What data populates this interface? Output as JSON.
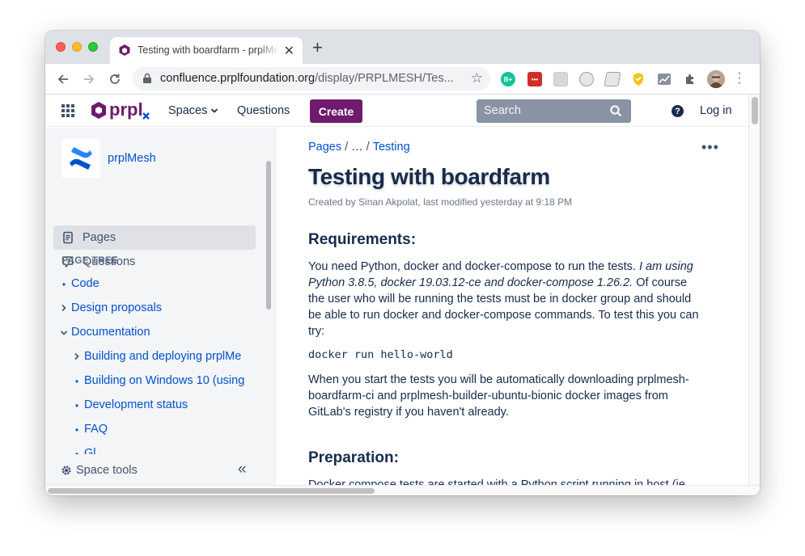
{
  "browser": {
    "tab_title": "Testing with boardfarm - prplMesh - Confluence",
    "tab_close": "✕",
    "new_tab": "+",
    "url_host": "confluence.prplfoundation.org",
    "url_path": "/display/PRPLMESH/Tes...",
    "extensions": [
      {
        "name": "grammarly-extension",
        "label": "B+",
        "color": "#15c39a"
      },
      {
        "name": "lastpass-extension",
        "label": "•••",
        "color": "#d32d27"
      },
      {
        "name": "grid-extension",
        "label": "",
        "color": "#d5d8dc"
      },
      {
        "name": "clock-extension",
        "label": "",
        "color": "#e4e6e9"
      },
      {
        "name": "notes-extension",
        "label": "",
        "color": "#e4e6e9"
      },
      {
        "name": "shield-extension",
        "label": "",
        "color": "#f5c518"
      },
      {
        "name": "chart-extension",
        "label": "",
        "color": "#8a9099"
      }
    ]
  },
  "header": {
    "logo_text": "prpl",
    "spaces_label": "Spaces",
    "questions_label": "Questions",
    "create_label": "Create",
    "search_placeholder": "Search",
    "help_label": "?",
    "login_label": "Log in",
    "brand_color": "#6e1b6b"
  },
  "sidebar": {
    "space_name": "prplMesh",
    "items": [
      {
        "label": "Pages",
        "active": true
      },
      {
        "label": "Questions",
        "active": false
      }
    ],
    "tree_heading": "PAGE TREE",
    "tree": [
      {
        "label": "Code",
        "marker": "bullet",
        "level": 0
      },
      {
        "label": "Design proposals",
        "marker": "chevron-right",
        "level": 0
      },
      {
        "label": "Documentation",
        "marker": "chevron-down",
        "level": 0
      },
      {
        "label": "Building and deploying prplMe",
        "marker": "chevron-right",
        "level": 1
      },
      {
        "label": "Building on Windows 10 (using",
        "marker": "bullet",
        "level": 1
      },
      {
        "label": "Development status",
        "marker": "bullet",
        "level": 1
      },
      {
        "label": "FAQ",
        "marker": "bullet",
        "level": 1
      },
      {
        "label": "Gl",
        "marker": "bullet",
        "level": 1
      }
    ],
    "space_tools": "Space tools",
    "collapse": "«"
  },
  "main": {
    "breadcrumb": {
      "root": "Pages",
      "ellipsis": "…",
      "current": "Testing"
    },
    "more_actions": "•••",
    "title": "Testing with boardfarm",
    "byline": "Created by Sinan Akpolat, last modified yesterday at 9:18 PM",
    "requirements_heading": "Requirements:",
    "req_para_1": "You need Python, docker and docker-compose to run the tests. ",
    "req_para_em": "I am using Python 3.8.5, docker 19.03.12-ce and docker-compose 1.26.2.",
    "req_para_2": " Of course the user who will be running the tests must be in docker group and should be able to run docker and docker-compose commands. To test this you can try:",
    "code": "docker run hello-world",
    "download_para": "When you start the tests you will be automatically downloading prplmesh-boardfarm-ci and prplmesh-builder-ubuntu-bionic docker images from GitLab's registry if you haven't already.",
    "preparation_heading": "Preparation:",
    "prep_para": "Docker compose tests are started with a Python script running in host (ie"
  }
}
